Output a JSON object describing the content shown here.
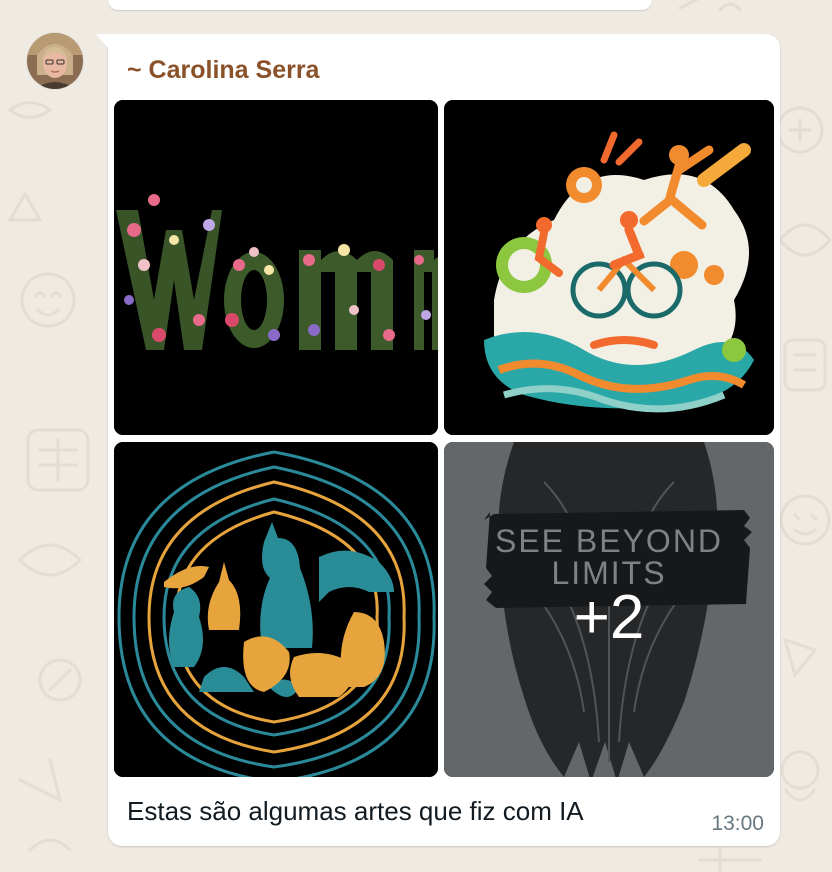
{
  "message": {
    "sender": "~ Carolina Serra",
    "sender_color": "#8b5128",
    "caption": "Estas são algumas artes que fiz com IA",
    "time": "13:00"
  },
  "images": [
    {
      "subject": "floral-lettering-art"
    },
    {
      "subject": "triathlon-art"
    },
    {
      "subject": "animals-silhouette-art"
    },
    {
      "subject": "eagle-poster-art",
      "poster_text": [
        "SEE BEYOND",
        "LIMITS"
      ]
    }
  ],
  "more_count": "+2",
  "colors": {
    "wallpaper": "#efeae2",
    "bubble": "#ffffff",
    "time": "#667781"
  }
}
